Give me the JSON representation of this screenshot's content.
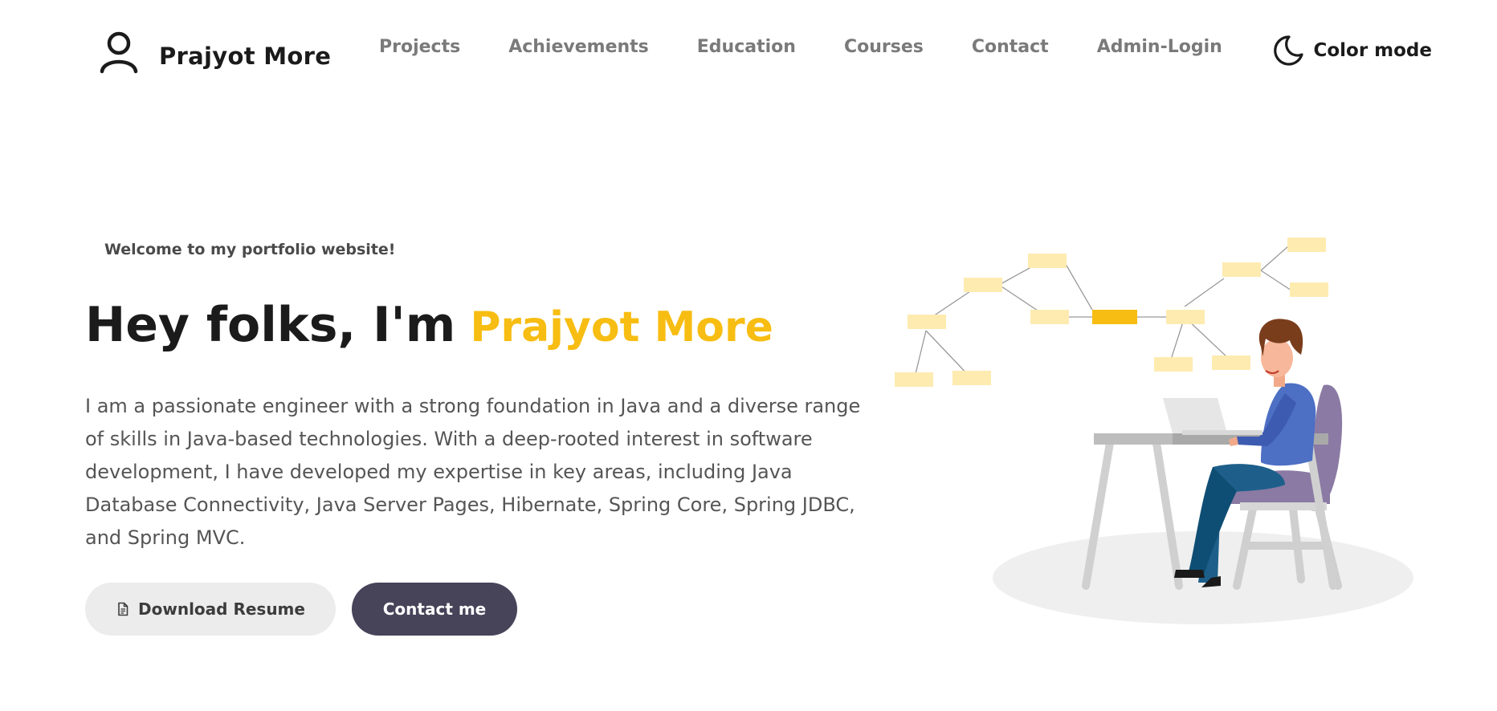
{
  "navbar": {
    "brand_name": "Prajyot More",
    "links": [
      "Projects",
      "Achievements",
      "Education",
      "Courses",
      "Contact",
      "Admin-Login"
    ],
    "color_mode_label": "Color mode"
  },
  "hero": {
    "welcome": "Welcome to my portfolio website!",
    "greeting": "Hey folks, I'm",
    "name": "Prajyot More",
    "bio": "I am a passionate engineer with a strong foundation in Java and a diverse range of skills in Java-based technologies. With a deep-rooted interest in software development, I have developed my expertise in key areas, including Java Database Connectivity, Java Server Pages, Hibernate, Spring Core, Spring JDBC, and Spring MVC.",
    "download_label": "Download Resume",
    "contact_label": "Contact me"
  },
  "colors": {
    "accent": "#f7bd12",
    "primary_button": "#474359",
    "secondary_button": "#ececec",
    "nav_text": "#7a7a7a"
  },
  "icons": {
    "brand": "user-icon",
    "color_mode": "moon-icon",
    "download": "document-icon"
  }
}
